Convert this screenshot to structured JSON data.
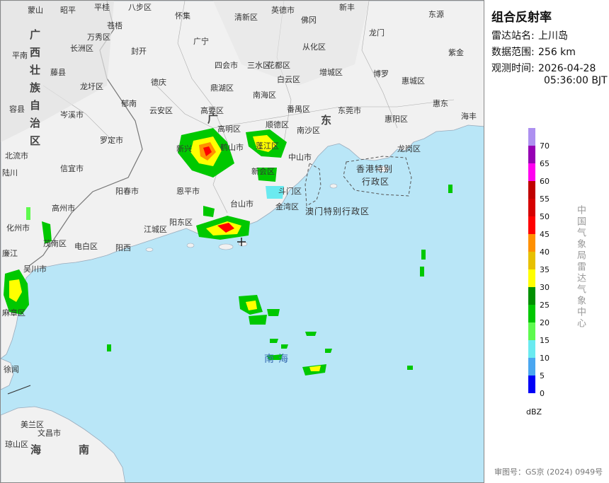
{
  "title": "组合反射率",
  "station": {
    "label": "雷达站名:",
    "value": "上川岛"
  },
  "range": {
    "label": "数据范围:",
    "value": "256 km"
  },
  "obs_time": {
    "label": "观测时间:",
    "value_line1": "2026-04-28",
    "value_line2": "05:36:00 BJT"
  },
  "legend": {
    "unit": "dBZ",
    "ticks": [
      "70",
      "65",
      "60",
      "55",
      "50",
      "45",
      "40",
      "35",
      "30",
      "25",
      "20",
      "15",
      "10",
      "5",
      "0"
    ],
    "colors": [
      "#ad90f0",
      "#9600b4",
      "#ff00f0",
      "#c00000",
      "#d60000",
      "#ff0000",
      "#ff9000",
      "#e7c000",
      "#ffff00",
      "#009000",
      "#00c800",
      "#5efa4e",
      "#6aeaf0",
      "#4aa6f0",
      "#0000f6"
    ]
  },
  "agency": "中国气象局雷达气象中心",
  "footer": "审图号：GS京 (2024) 0949号",
  "map": {
    "province_labels": {
      "guangxi": "广西壮族自治区",
      "guangdong_1": "广",
      "guangdong_2": "东",
      "hainan_1": "海",
      "hainan_2": "南"
    },
    "sea_label": "南海",
    "sar_hk": [
      "香港特别",
      "行政区"
    ],
    "sar_macau": "澳门特别行政区",
    "cities": {
      "c01": "蒙山",
      "c02": "昭平",
      "c03": "平桂",
      "c04": "八步区",
      "c05": "怀集",
      "c06": "英德市",
      "c07": "新丰",
      "c08": "东源",
      "c09": "苍梧",
      "c10": "万秀区",
      "c11": "长洲区",
      "c12": "封开",
      "c13": "广宁",
      "c14": "清新区",
      "c15": "佛冈",
      "c16": "从化区",
      "c17": "龙门",
      "c18": "平南",
      "c19": "藤县",
      "c20": "德庆",
      "c21": "四会市",
      "c22": "花都区",
      "c23": "增城区",
      "c24": "博罗",
      "c25": "紫金",
      "c26": "容县",
      "c27": "龙圩区",
      "c28": "郁南",
      "c29": "鼎湖区",
      "c30": "三水区",
      "c31": "白云区",
      "c32": "惠城区",
      "c33": "岑溪市",
      "c34": "云安区",
      "c35": "南海区",
      "c36": "番禺区",
      "c37": "东莞市",
      "c38": "惠东",
      "c39": "海丰",
      "c40": "罗定市",
      "c41": "高要区",
      "c42": "高明区",
      "c43": "顺德区",
      "c44": "南沙区",
      "c45": "惠阳区",
      "c46": "龙岗区",
      "c47": "北流市",
      "c48": "新兴",
      "c49": "鹤山市",
      "c50": "蓬江区",
      "c51": "中山市",
      "c52": "信宜市",
      "c53": "新会区",
      "c54": "阳春市",
      "c55": "恩平市",
      "c56": "斗门区",
      "c57": "金湾区",
      "c58": "高州市",
      "c59": "台山市",
      "c60": "阳东区",
      "c61": "化州市",
      "c62": "江城区",
      "c63": "茂南区",
      "c64": "电白区",
      "c65": "阳西",
      "c66": "吴川市",
      "c67": "麻章区",
      "c68": "徐闻",
      "c69": "文昌市",
      "c70": "美兰区",
      "c71": "琼山区",
      "c72": "陆川",
      "c73": "廉江"
    }
  }
}
